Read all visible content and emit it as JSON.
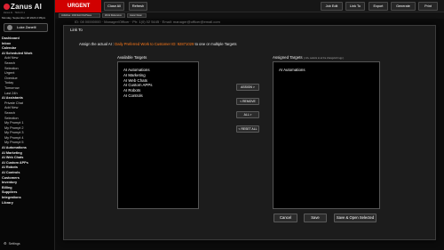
{
  "brand": {
    "name": "Zanus AI",
    "subtitle": "Zanus AI · TECH 0.1",
    "date": "Monday, September 18 2023 2:05pm"
  },
  "user": {
    "name": "Luke Zanelli"
  },
  "sidebar": {
    "items": [
      {
        "label": "Dashboard",
        "type": "bold"
      },
      {
        "label": "Inbox",
        "type": "bold"
      },
      {
        "label": "Calendar",
        "type": "bold"
      },
      {
        "label": "AI Scheduled Work",
        "type": "bold"
      },
      {
        "label": "Add New",
        "type": "sub"
      },
      {
        "label": "Search",
        "type": "sub"
      },
      {
        "label": "Selection",
        "type": "sub"
      },
      {
        "label": "Urgent",
        "type": "sub"
      },
      {
        "label": "Overdue",
        "type": "sub"
      },
      {
        "label": "Today",
        "type": "sub"
      },
      {
        "label": "Tomorrow",
        "type": "sub"
      },
      {
        "label": "Last 24h",
        "type": "sub"
      },
      {
        "label": "AI Assistants",
        "type": "bold"
      },
      {
        "label": "Private Chat",
        "type": "sub"
      },
      {
        "label": "Add New",
        "type": "sub"
      },
      {
        "label": "Search",
        "type": "sub"
      },
      {
        "label": "Selection",
        "type": "sub"
      },
      {
        "label": "My Prompt 1",
        "type": "sub"
      },
      {
        "label": "My Prompt 2",
        "type": "sub"
      },
      {
        "label": "My Prompt 3",
        "type": "sub"
      },
      {
        "label": "My Prompt 4",
        "type": "sub"
      },
      {
        "label": "My Prompt 5",
        "type": "sub"
      },
      {
        "label": "AI Automations",
        "type": "bold"
      },
      {
        "label": "AI Marketing",
        "type": "bold"
      },
      {
        "label": "AI Web Chats",
        "type": "bold"
      },
      {
        "label": "AI Custom APPs",
        "type": "bold"
      },
      {
        "label": "AI Robots",
        "type": "bold"
      },
      {
        "label": "AI Controls",
        "type": "bold"
      },
      {
        "label": "Customers",
        "type": "bold"
      },
      {
        "label": "Inventory",
        "type": "bold"
      },
      {
        "label": "Billing",
        "type": "bold"
      },
      {
        "label": "Suppliers",
        "type": "bold"
      },
      {
        "label": "Integrations",
        "type": "bold"
      },
      {
        "label": "Library",
        "type": "bold"
      }
    ],
    "settings": "Settings"
  },
  "topbar": {
    "urgent": "URGENT",
    "close_all": "Close All",
    "refresh": "Refresh",
    "job_edit": "Job Edit",
    "link_to": "Link To",
    "export": "Export",
    "generate": "Generate",
    "print": "Print"
  },
  "tabs": [
    "JobsDue: 1023 EH 0/12/Save",
    "Work Relevance",
    "Jason Dean"
  ],
  "infobar": "ID: 08 00000000 · Manager/Officer · Ph: 1(0) 02 5445 · Email: manager@officer@email.com",
  "modal": {
    "title": "Link To",
    "instruction_prefix": "Assign the actual AI : ",
    "instruction_highlight": "Daily Preferred Work to Customer ID: 92871029",
    "instruction_suffix": "  to one or multiple Targets",
    "available_label": "Available Targets",
    "assigned_label": "Assigned Targets",
    "assigned_hint": "( ctrl+ selects to at the change\\ctrl sgp )",
    "available": [
      "AI Automations",
      "AI Marketing",
      "AI Web Chats",
      "AI Custom APPs",
      "AI Robots",
      "AI Controls"
    ],
    "assigned": [
      "AI Automations"
    ],
    "assign_btn": "ASSIGN >",
    "remove_btn": "< REMOVE",
    "all_btn": "ALL >",
    "reset_btn": "< RESET ALL",
    "cancel": "Cancel",
    "save": "Save",
    "save_open": "Save & Open Selected"
  }
}
